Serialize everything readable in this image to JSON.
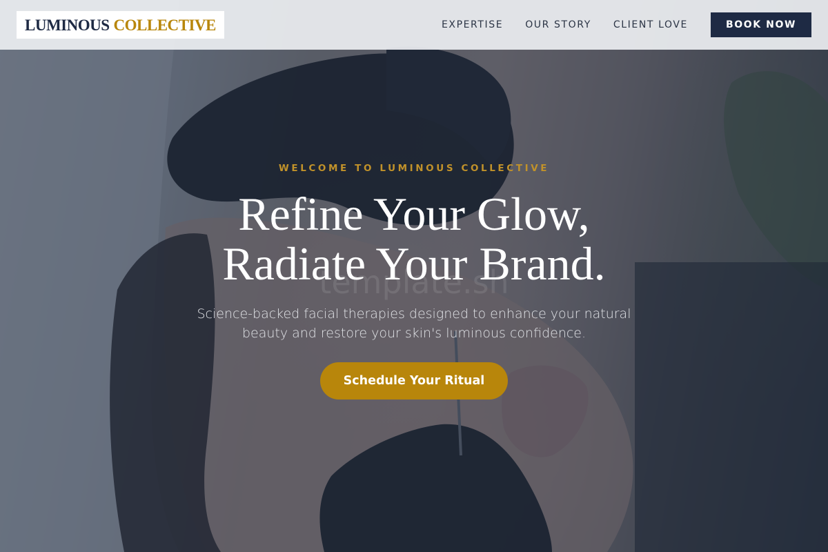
{
  "brand": {
    "name_part1": "LUMINOUS",
    "name_part2": "COLLECTIVE",
    "primary_color": "#1e2a44",
    "accent_color": "#b8860b"
  },
  "nav": {
    "items": [
      {
        "label": "EXPERTISE"
      },
      {
        "label": "OUR STORY"
      },
      {
        "label": "CLIENT LOVE"
      }
    ],
    "cta_label": "BOOK NOW"
  },
  "hero": {
    "background_image": "facial-treatment-photo",
    "eyebrow": "WELCOME TO LUMINOUS COLLECTIVE",
    "headline_line1": "Refine Your Glow,",
    "headline_line2": "Radiate Your Brand.",
    "watermark": "template.sh",
    "subtext": "Science-backed facial therapies designed to enhance your natural beauty and restore your skin's luminous confidence.",
    "cta_label": "Schedule Your Ritual"
  }
}
